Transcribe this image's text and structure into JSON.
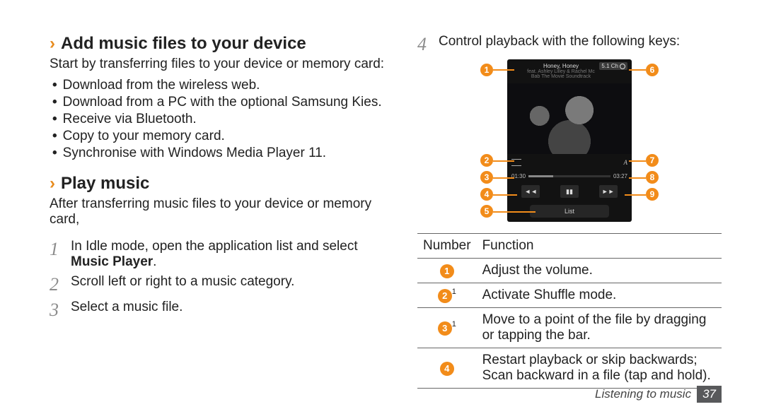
{
  "left": {
    "heading1": "Add music files to your device",
    "intro1": "Start by transferring files to your device or memory card:",
    "bullets": [
      "Download from the wireless web.",
      "Download from a PC with the optional Samsung Kies.",
      "Receive via Bluetooth.",
      "Copy to your memory card.",
      "Synchronise with Windows Media Player 11."
    ],
    "heading2": "Play music",
    "after": "After transferring music files to your device or memory card,",
    "steps": [
      {
        "n": "1",
        "pre": "In Idle mode, open the application list and select ",
        "bold": "Music Player",
        "post": "."
      },
      {
        "n": "2",
        "text": "Scroll left or right to a music category."
      },
      {
        "n": "3",
        "text": "Select a music file."
      }
    ]
  },
  "right": {
    "step4": {
      "n": "4",
      "text": "Control playback with the following keys:"
    },
    "shot": {
      "title": "Honey, Honey",
      "artists": "feat. Ashley Lilley & Rachel Mc",
      "album": "Bab The Movie Soundtrack",
      "sound": "5.1 Ch",
      "time_cur": "01:30",
      "time_tot": "03:27",
      "list": "List",
      "a_label": "A"
    },
    "callouts": [
      "1",
      "2",
      "3",
      "4",
      "5",
      "6",
      "7",
      "8",
      "9"
    ],
    "table": {
      "head": [
        "Number",
        "Function"
      ],
      "rows": [
        {
          "num": "1",
          "sup": "",
          "fn": "Adjust the volume."
        },
        {
          "num": "2",
          "sup": "1",
          "fn": "Activate Shuffle mode."
        },
        {
          "num": "3",
          "sup": "1",
          "fn": "Move to a point of the file by dragging or tapping the bar."
        },
        {
          "num": "4",
          "sup": "",
          "fn": "Restart playback or skip backwards; Scan backward in a file (tap and hold)."
        }
      ]
    }
  },
  "footer": {
    "section": "Listening to music",
    "page": "37"
  }
}
